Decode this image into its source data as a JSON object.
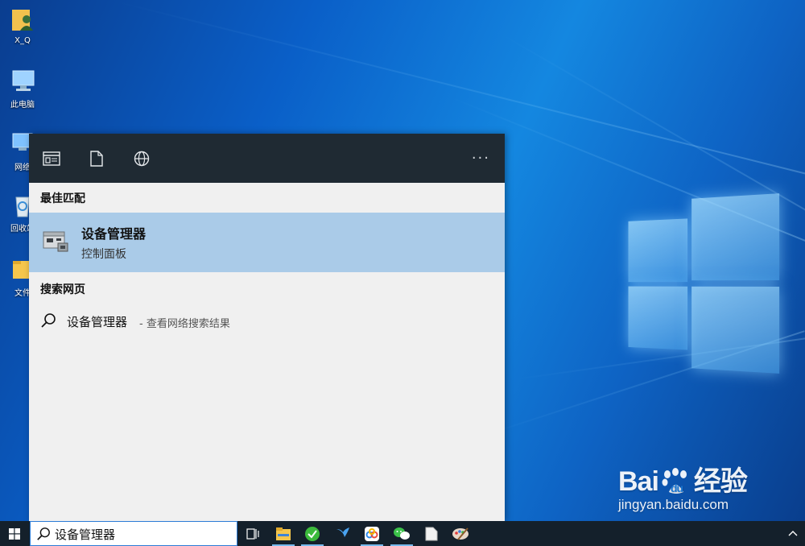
{
  "desktop": {
    "icons": [
      {
        "label": "X_Q",
        "icon": "user-folder-icon"
      },
      {
        "label": "此电脑",
        "icon": "computer-icon"
      },
      {
        "label": "网络",
        "icon": "network-icon"
      },
      {
        "label": "回收站",
        "icon": "recycle-bin-icon"
      },
      {
        "label": "文件",
        "icon": "folder-icon"
      }
    ]
  },
  "search_panel": {
    "toolbar": {
      "apps_icon": "apps-filter-icon",
      "documents_icon": "documents-filter-icon",
      "web_icon": "web-filter-icon",
      "more_label": "···"
    },
    "best_match": {
      "section_title": "最佳匹配",
      "name": "设备管理器",
      "subtitle": "控制面板"
    },
    "web": {
      "section_title": "搜索网页",
      "query": "设备管理器",
      "hint": "- 查看网络搜索结果"
    }
  },
  "taskbar": {
    "search_value": "设备管理器",
    "apps": [
      "task-view-icon",
      "file-explorer-icon",
      "green-app-icon",
      "bird-app-icon",
      "baidu-netdisk-icon",
      "wechat-icon",
      "notepad-icon",
      "paint-icon"
    ],
    "tray_icon": "chevron-up-icon"
  },
  "watermark": {
    "brand": "Bai",
    "brand_suffix": "经验",
    "url": "jingyan.baidu.com"
  },
  "colors": {
    "panel_bg": "#f0f0f0",
    "toolbar_bg": "#1f2a33",
    "selected_row": "#aacbe8",
    "taskbar_bg": "#14202b",
    "accent": "#2b7bd6"
  }
}
